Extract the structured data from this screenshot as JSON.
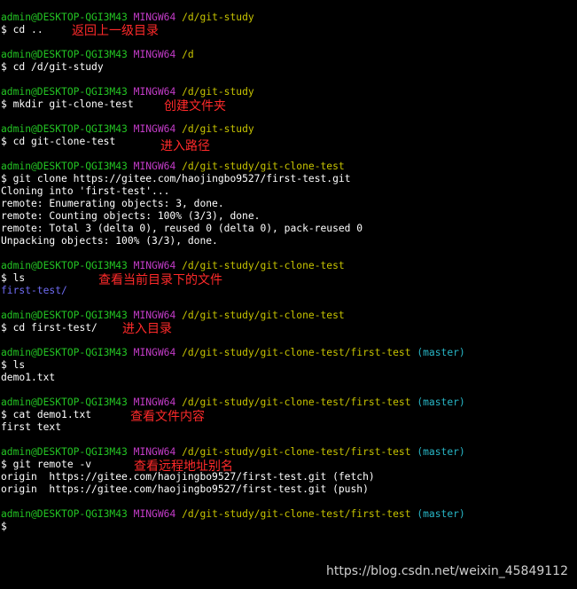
{
  "prompt": {
    "user": "admin@DESKTOP-QGI3M43",
    "system": "MINGW64",
    "symbol": "$"
  },
  "lines": [
    {
      "path": "/d/git-study",
      "cmd": "cd ..",
      "note": "返回上一级目录"
    },
    {
      "path": "/d",
      "cmd": "cd /d/git-study"
    },
    {
      "path": "/d/git-study",
      "cmd": "mkdir git-clone-test",
      "note": "创建文件夹"
    },
    {
      "path": "/d/git-study",
      "cmd": "cd git-clone-test",
      "note": "进入路径"
    },
    {
      "path": "/d/git-study/git-clone-test",
      "cmd": "git clone https://gitee.com/haojingbo9527/first-test.git"
    },
    {
      "output": "Cloning into 'first-test'..."
    },
    {
      "output": "remote: Enumerating objects: 3, done."
    },
    {
      "output": "remote: Counting objects: 100% (3/3), done."
    },
    {
      "output": "remote: Total 3 (delta 0), reused 0 (delta 0), pack-reused 0"
    },
    {
      "output": "Unpacking objects: 100% (3/3), done."
    },
    {
      "path": "/d/git-study/git-clone-test",
      "cmd": "ls",
      "note": "查看当前目录下的文件"
    },
    {
      "dir_output": "first-test/"
    },
    {
      "path": "/d/git-study/git-clone-test",
      "cmd": "cd first-test/",
      "note": "进入目录"
    },
    {
      "path": "/d/git-study/git-clone-test/first-test",
      "branch": "(master)",
      "cmd": "ls"
    },
    {
      "output": "demo1.txt"
    },
    {
      "path": "/d/git-study/git-clone-test/first-test",
      "branch": "(master)",
      "cmd": "cat demo1.txt",
      "note": "查看文件内容"
    },
    {
      "output": "first text"
    },
    {
      "path": "/d/git-study/git-clone-test/first-test",
      "branch": "(master)",
      "cmd": "git remote -v",
      "note": "查看远程地址别名"
    },
    {
      "output": "origin  https://gitee.com/haojingbo9527/first-test.git (fetch)"
    },
    {
      "output": "origin  https://gitee.com/haojingbo9527/first-test.git (push)"
    },
    {
      "path": "/d/git-study/git-clone-test/first-test",
      "branch": "(master)",
      "cmd": ""
    }
  ],
  "watermark": "https://blog.csdn.net/weixin_45849112"
}
